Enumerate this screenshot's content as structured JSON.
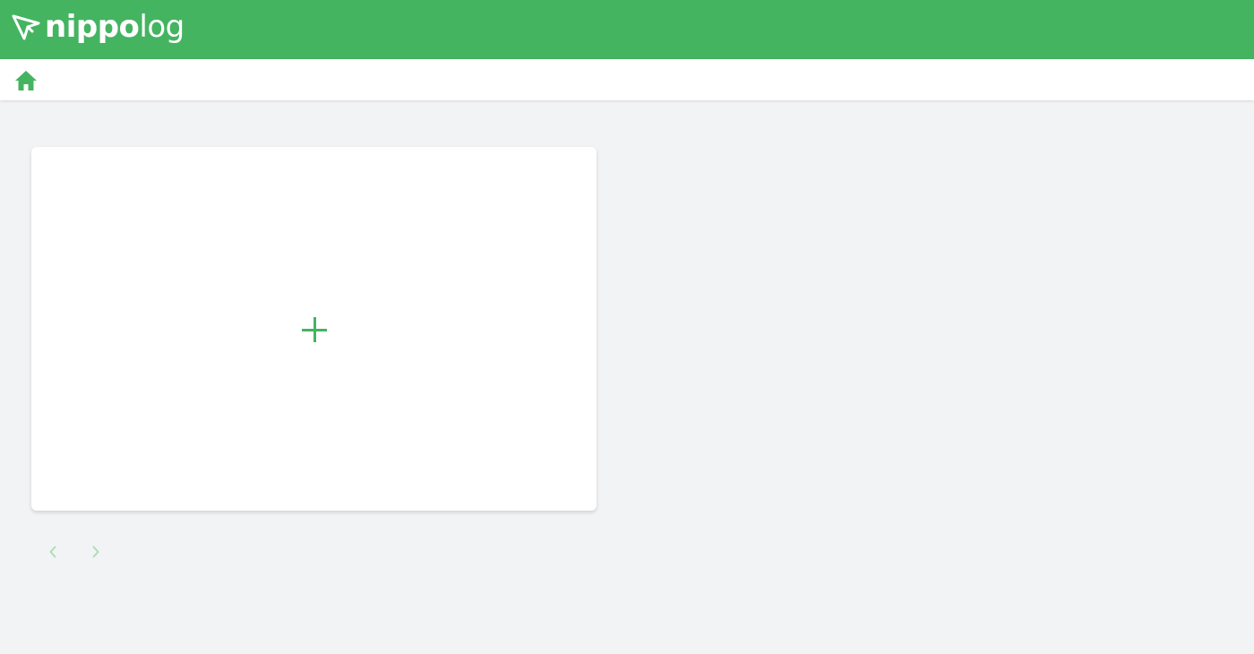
{
  "app": {
    "brand_bold": "nippo",
    "brand_light": "log",
    "accent_color": "#44b461",
    "logo_icon": "paper-plane-icon"
  },
  "navbar": {
    "home_icon": "home-icon"
  },
  "main": {
    "add_card_icon": "plus-icon"
  },
  "pager": {
    "prev_icon": "chevron-left-icon",
    "next_icon": "chevron-right-icon",
    "prev_disabled": true,
    "next_disabled": true
  }
}
